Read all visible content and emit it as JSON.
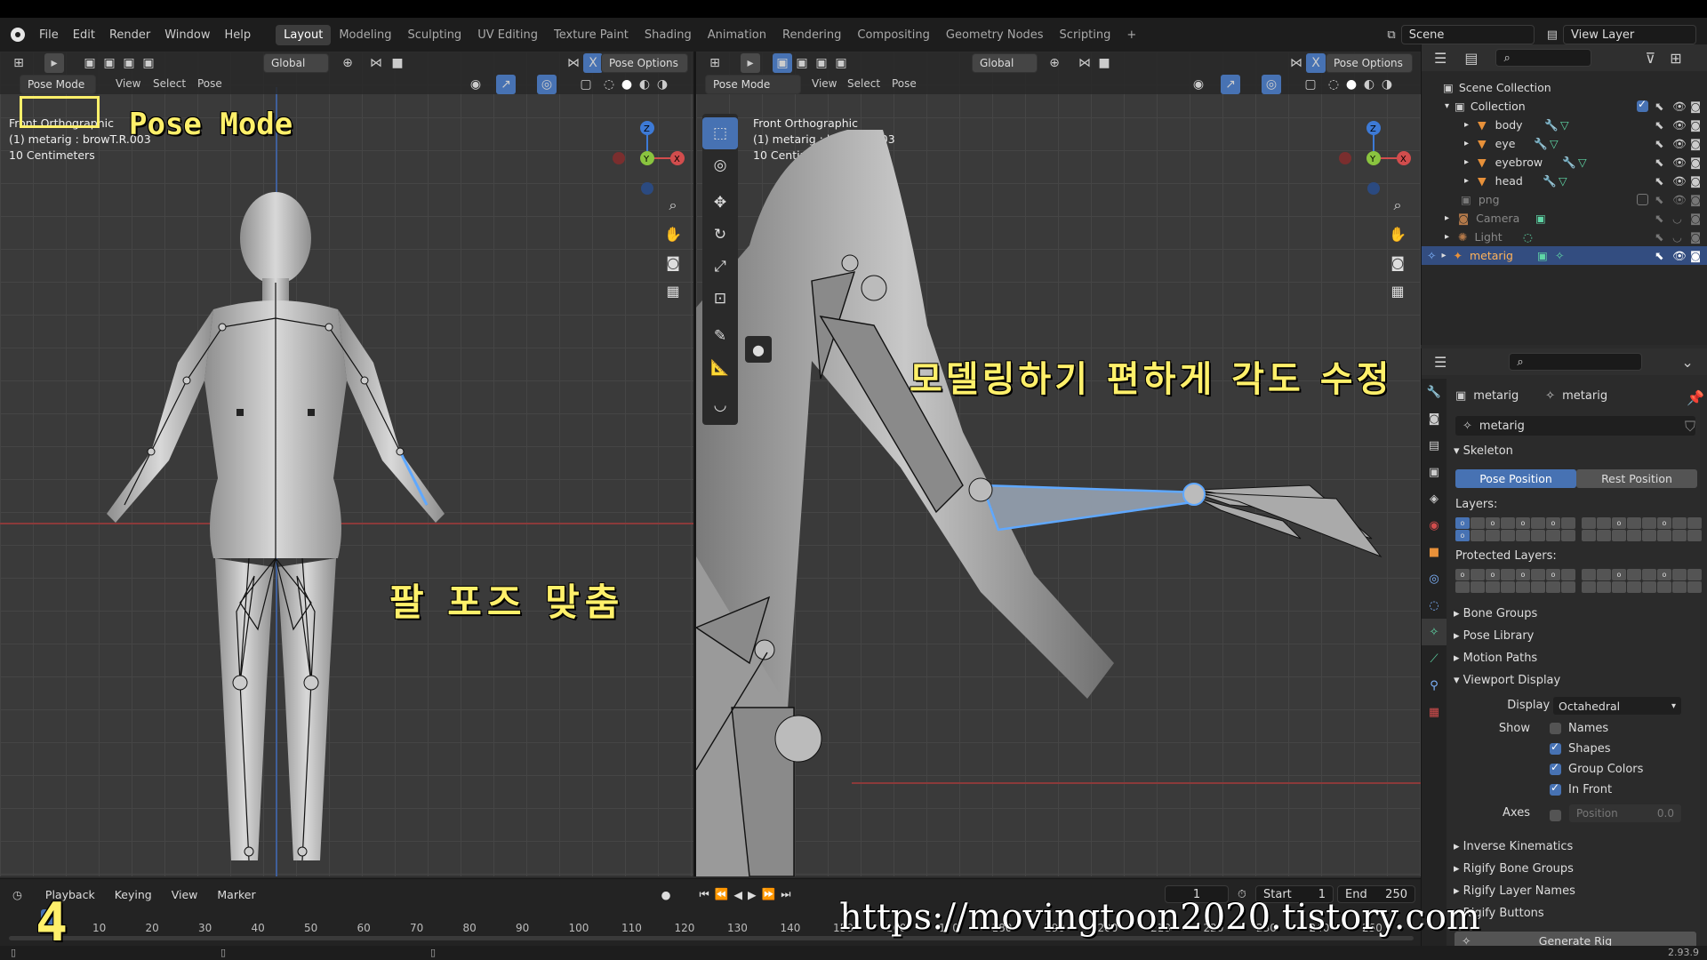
{
  "topbar": {
    "menus": [
      "File",
      "Edit",
      "Render",
      "Window",
      "Help"
    ],
    "workspaces": [
      "Layout",
      "Modeling",
      "Sculpting",
      "UV Editing",
      "Texture Paint",
      "Shading",
      "Animation",
      "Rendering",
      "Compositing",
      "Geometry Nodes",
      "Scripting"
    ],
    "active_workspace": "Layout",
    "add_tab": "+",
    "scene": "Scene",
    "view_layer": "View Layer"
  },
  "left_viewport": {
    "transform": "Global",
    "pose_options": "Pose Options",
    "menu_view": "View",
    "menu_select": "Select",
    "menu_pose": "Pose",
    "mode": "Pose Mode",
    "info_line1": "Front Orthographic",
    "info_line2": "(1) metarig : browT.R.003",
    "info_line3": "10 Centimeters",
    "gizmo_z": "Z",
    "gizmo_y": "Y",
    "gizmo_x": "X"
  },
  "right_viewport": {
    "mode": "Pose Mode",
    "menu_view": "View",
    "menu_select": "Select",
    "menu_pose": "Pose",
    "transform": "Global",
    "pose_options": "Pose Options",
    "info_line1": "Front Orthographic",
    "info_line2": "(1) metarig : browT.R.003",
    "info_line3": "10 Centimeters",
    "gizmo_z": "Z",
    "gizmo_y": "Y",
    "gizmo_x": "X"
  },
  "overlays": {
    "pose_mode_label": "Pose Mode",
    "arm_pose_caption": "팔 포즈 맞춤",
    "angle_caption": "모델링하기 편하게 각도 수정",
    "step_number": "4",
    "watermark": "https://movingtoon2020.tistory.com"
  },
  "outliner": {
    "scene_collection": "Scene Collection",
    "collection": "Collection",
    "items": [
      "body",
      "eye",
      "eyebrow",
      "head"
    ],
    "png": "png",
    "camera": "Camera",
    "light": "Light",
    "metarig": "metarig"
  },
  "properties": {
    "breadcrumb_object": "metarig",
    "breadcrumb_data": "metarig",
    "data_name": "metarig",
    "skeleton": "Skeleton",
    "pose_position": "Pose Position",
    "rest_position": "Rest Position",
    "layers_label": "Layers:",
    "protected_layers_label": "Protected Layers:",
    "bone_groups": "Bone Groups",
    "pose_library": "Pose Library",
    "motion_paths": "Motion Paths",
    "viewport_display": "Viewport Display",
    "display_as_label": "Display As",
    "display_as_value": "Octahedral",
    "show_label": "Show",
    "names": "Names",
    "names_checked": false,
    "shapes": "Shapes",
    "shapes_checked": true,
    "group_colors": "Group Colors",
    "group_colors_checked": true,
    "in_front": "In Front",
    "in_front_checked": true,
    "axes_label": "Axes",
    "axes_position_label": "Position",
    "axes_position_value": "0.0",
    "inverse_kinematics": "Inverse Kinematics",
    "rigify_bone_groups": "Rigify Bone Groups",
    "rigify_layer_names": "Rigify Layer Names",
    "rigify_buttons": "Rigify Buttons",
    "generate_rig": "Generate Rig"
  },
  "timeline": {
    "playback": "Playback",
    "keying": "Keying",
    "view": "View",
    "marker": "Marker",
    "current_frame": "1",
    "start_label": "Start",
    "start_value": "1",
    "end_label": "End",
    "end_value": "250",
    "ticks": [
      "10",
      "20",
      "30",
      "40",
      "50",
      "60",
      "70",
      "80",
      "90",
      "100",
      "110",
      "120",
      "130",
      "140",
      "150",
      "160",
      "170",
      "180",
      "190",
      "200",
      "210",
      "220",
      "230",
      "240",
      "250"
    ]
  },
  "statusbar": {
    "version": "2.93.9"
  },
  "colors": {
    "accent": "#4772b3",
    "caption_yellow": "#fff06a",
    "x_axis": "#d24d4d",
    "y_axis": "#8ac43f",
    "z_axis": "#3d7ad6"
  }
}
